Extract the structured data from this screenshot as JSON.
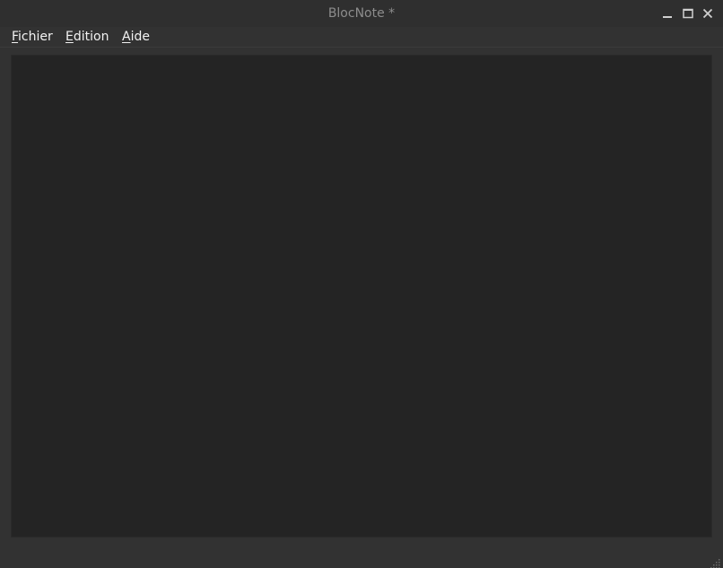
{
  "window": {
    "title": "BlocNote *"
  },
  "window_controls": {
    "minimize_icon": "minimize-icon",
    "maximize_icon": "maximize-icon",
    "close_icon": "close-icon"
  },
  "menubar": {
    "items": [
      {
        "mnemonic": "F",
        "rest": "ichier"
      },
      {
        "mnemonic": "E",
        "rest": "dition"
      },
      {
        "mnemonic": "A",
        "rest": "ide"
      }
    ]
  },
  "editor": {
    "value": ""
  },
  "colors": {
    "window_bg": "#323232",
    "editor_bg": "#242424",
    "text": "#f2f2f2",
    "title_text": "#8c8c8c"
  }
}
